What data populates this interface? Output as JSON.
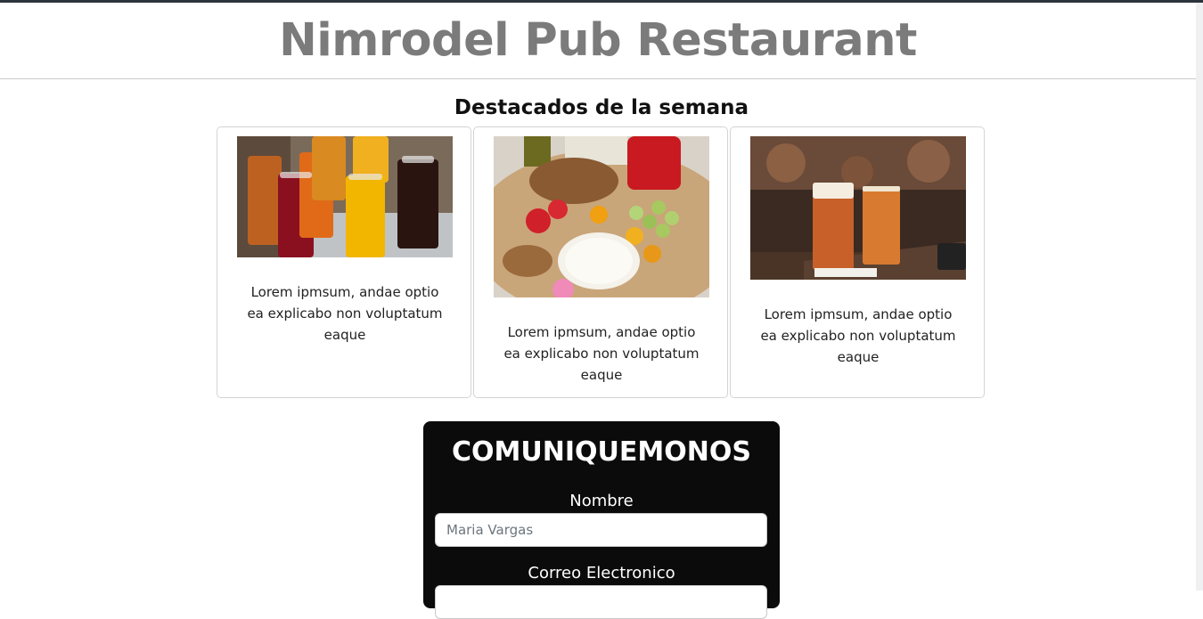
{
  "header": {
    "title": "Nimrodel Pub Restaurant"
  },
  "featured": {
    "title": "Destacados de la semana",
    "cards": [
      {
        "image": "juice-glasses-photo",
        "text": "Lorem ipmsum, andae optio ea explicabo non voluptatum eaque"
      },
      {
        "image": "cheese-fruit-platter-photo",
        "text": "Lorem ipmsum, andae optio ea explicabo non voluptatum eaque"
      },
      {
        "image": "beer-glasses-photo",
        "text": "Lorem ipmsum, andae optio ea explicabo non voluptatum eaque"
      }
    ]
  },
  "contact": {
    "title": "COMUNIQUEMONOS",
    "name_label": "Nombre",
    "name_placeholder": "Maria Vargas",
    "email_label": "Correo Electronico",
    "email_placeholder": ""
  }
}
